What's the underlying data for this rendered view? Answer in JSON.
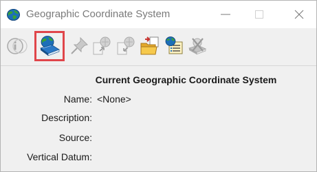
{
  "window": {
    "title": "Geographic Coordinate System",
    "title_icon": "globe-icon",
    "controls": [
      {
        "name": "minimize",
        "glyph": "—"
      },
      {
        "name": "maximize",
        "glyph": "☐"
      },
      {
        "name": "close",
        "glyph": "✕"
      }
    ]
  },
  "toolbar": {
    "buttons": [
      {
        "icon": "info-icon",
        "enabled": false
      },
      {
        "icon": "select-from-library-icon",
        "enabled": true,
        "highlighted": true
      },
      {
        "icon": "pushpin-icon",
        "enabled": false
      },
      {
        "icon": "export-icon",
        "enabled": false
      },
      {
        "icon": "import-icon",
        "enabled": false
      },
      {
        "icon": "open-folder-icon",
        "enabled": true
      },
      {
        "icon": "globe-list-icon",
        "enabled": true
      },
      {
        "icon": "delete-icon",
        "enabled": false
      }
    ],
    "highlight_color": "#e0454a"
  },
  "main": {
    "heading": "Current Geographic Coordinate System",
    "fields": [
      {
        "label": "Name:",
        "value": "<None>"
      },
      {
        "label": "Description:",
        "value": ""
      },
      {
        "label": "Source:",
        "value": ""
      },
      {
        "label": "Vertical Datum:",
        "value": ""
      }
    ]
  }
}
